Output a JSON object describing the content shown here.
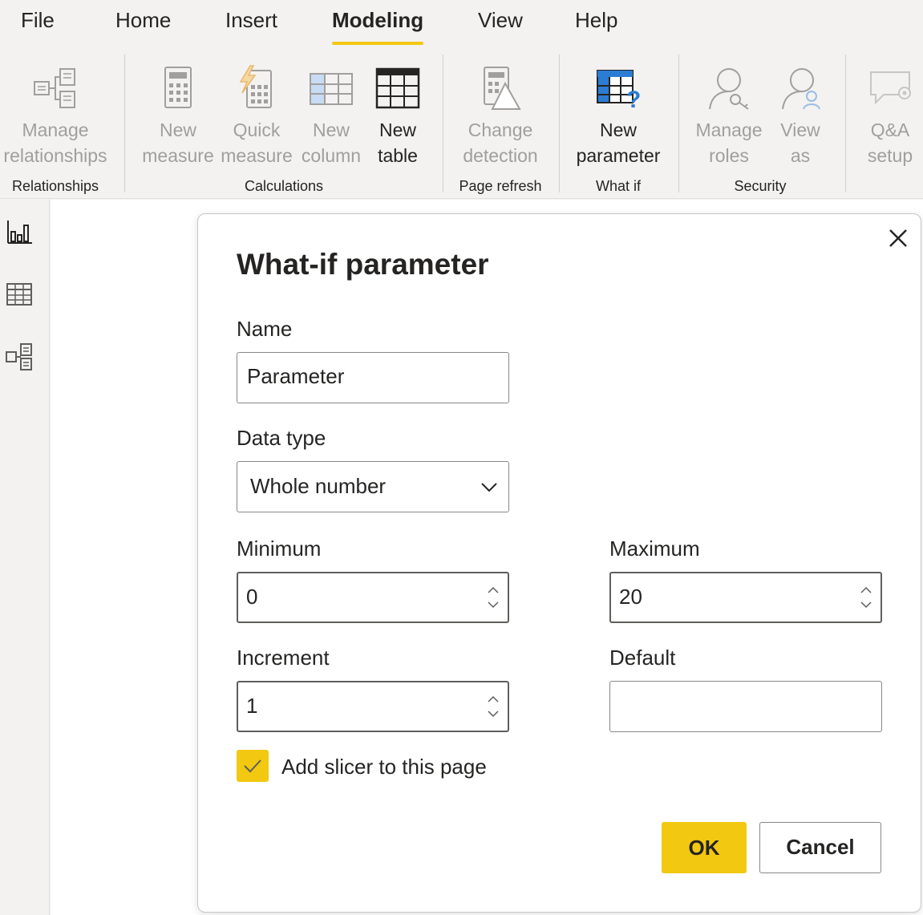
{
  "menu": {
    "tabs": [
      {
        "label": "File"
      },
      {
        "label": "Home"
      },
      {
        "label": "Insert"
      },
      {
        "label": "Modeling",
        "active": true
      },
      {
        "label": "View"
      },
      {
        "label": "Help"
      }
    ]
  },
  "ribbon": {
    "buttons": {
      "manage_relationships": "Manage\nrelationships",
      "new_measure": "New\nmeasure",
      "quick_measure": "Quick\nmeasure",
      "new_column": "New\ncolumn",
      "new_table": "New\ntable",
      "change_detection": "Change\ndetection",
      "new_parameter": "New\nparameter",
      "manage_roles": "Manage\nroles",
      "view_as": "View\nas",
      "qa_setup": "Q&A\nsetup"
    },
    "groups": {
      "relationships": "Relationships",
      "calculations": "Calculations",
      "page_refresh": "Page refresh",
      "what_if": "What if",
      "security": "Security"
    }
  },
  "rail": {
    "icons": [
      "report-view-icon",
      "data-view-icon",
      "model-view-icon"
    ]
  },
  "dialog": {
    "title": "What-if parameter",
    "name_label": "Name",
    "name_value": "Parameter",
    "data_type_label": "Data type",
    "data_type_value": "Whole number",
    "minimum_label": "Minimum",
    "minimum_value": "0",
    "maximum_label": "Maximum",
    "maximum_value": "20",
    "increment_label": "Increment",
    "increment_value": "1",
    "default_label": "Default",
    "default_value": "",
    "slicer_label": "Add slicer to this page",
    "slicer_checked": true,
    "ok_label": "OK",
    "cancel_label": "Cancel"
  },
  "colors": {
    "accent": "#f2c811",
    "ribbon_bg": "#f3f2f1",
    "disabled_text": "#a19f9d",
    "text": "#252423",
    "icon_blue": "#2b7cd3"
  }
}
